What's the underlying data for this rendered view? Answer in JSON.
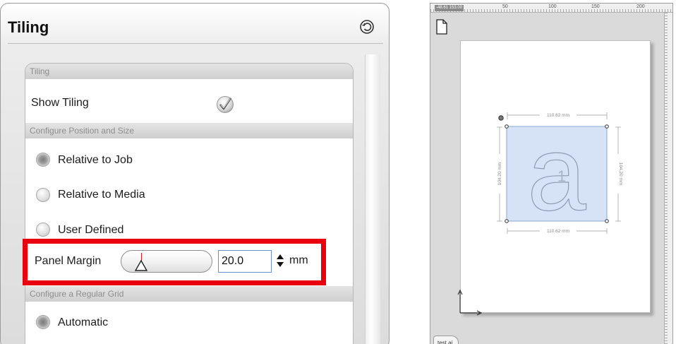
{
  "panel": {
    "title": "Tiling",
    "reset_icon": "reset-icon",
    "sections": {
      "tiling": "Tiling",
      "position_size": "Configure Position and Size",
      "regular_grid": "Configure a Regular Grid"
    },
    "show_tiling": {
      "label": "Show Tiling",
      "checked": true,
      "icon": "checkmark-icon"
    },
    "position_options": [
      {
        "label": "Relative to Job",
        "selected": true
      },
      {
        "label": "Relative to Media",
        "selected": false
      },
      {
        "label": "User Defined",
        "selected": false
      }
    ],
    "panel_margin": {
      "label": "Panel Margin",
      "value": "20.0",
      "unit": "mm"
    },
    "grid_options": [
      {
        "label": "Automatic",
        "selected": true
      }
    ],
    "highlight_color": "#e8000e"
  },
  "canvas": {
    "ruler_coord": "-48.61 153.00",
    "ruler_numbers": [
      "50",
      "100",
      "150",
      "200"
    ],
    "dimensions": {
      "width_top": "110.62 mm",
      "width_bottom": "110.62 mm",
      "height_left": "104.20 mm",
      "height_right": "104.20 mm"
    },
    "tile_number": "1",
    "glyph": "a",
    "file_tab": "test.ai",
    "selection_fill": "#d6e3f7"
  }
}
